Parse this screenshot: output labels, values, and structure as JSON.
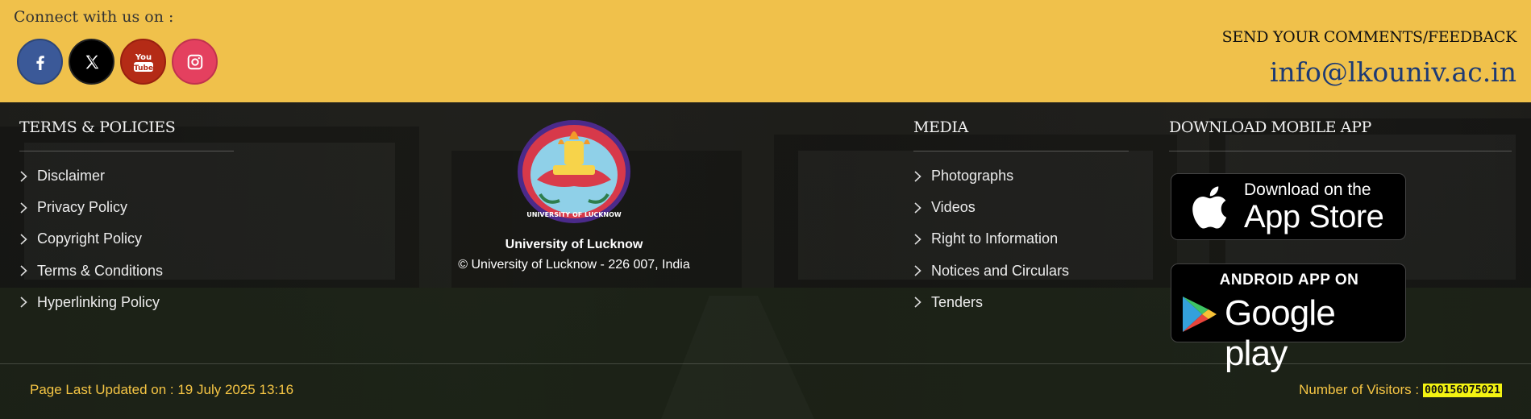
{
  "connect": {
    "label": "Connect with us on :",
    "social": [
      {
        "name": "facebook-icon",
        "color": "#3b5998"
      },
      {
        "name": "x-twitter-icon",
        "color": "#000000"
      },
      {
        "name": "youtube-icon",
        "color": "#b42b16"
      },
      {
        "name": "instagram-icon",
        "color": "#e4405f"
      }
    ]
  },
  "feedback": {
    "label": "SEND YOUR COMMENTS/FEEDBACK",
    "email": "info@lkouniv.ac.in"
  },
  "terms": {
    "heading": "TERMS & POLICIES",
    "links": [
      "Disclaimer",
      "Privacy Policy",
      "Copyright Policy",
      "Terms & Conditions",
      "Hyperlinking Policy"
    ]
  },
  "university": {
    "name": "University of Lucknow",
    "copyright": "© University of Lucknow - 226 007, India",
    "logo_text": "UNIVERSITY OF LUCKNOW"
  },
  "media": {
    "heading": "MEDIA",
    "links": [
      "Photographs",
      "Videos",
      "Right to Information",
      "Notices and Circulars",
      "Tenders"
    ]
  },
  "app": {
    "heading": "DOWNLOAD MOBILE APP",
    "apple_line1": "Download on the",
    "apple_line2": "App Store",
    "google_line1": "ANDROID APP ON",
    "google_line2": "Google play"
  },
  "footer": {
    "updated": "Page Last Updated on : 19 July 2025 13:16",
    "visitors_label": "Number of Visitors :",
    "visitors_count": "000156075021"
  },
  "colors": {
    "band": "#f0c14b",
    "email": "#1d3a74",
    "footer_text": "#f5c544",
    "counter_bg": "#f3f312"
  }
}
